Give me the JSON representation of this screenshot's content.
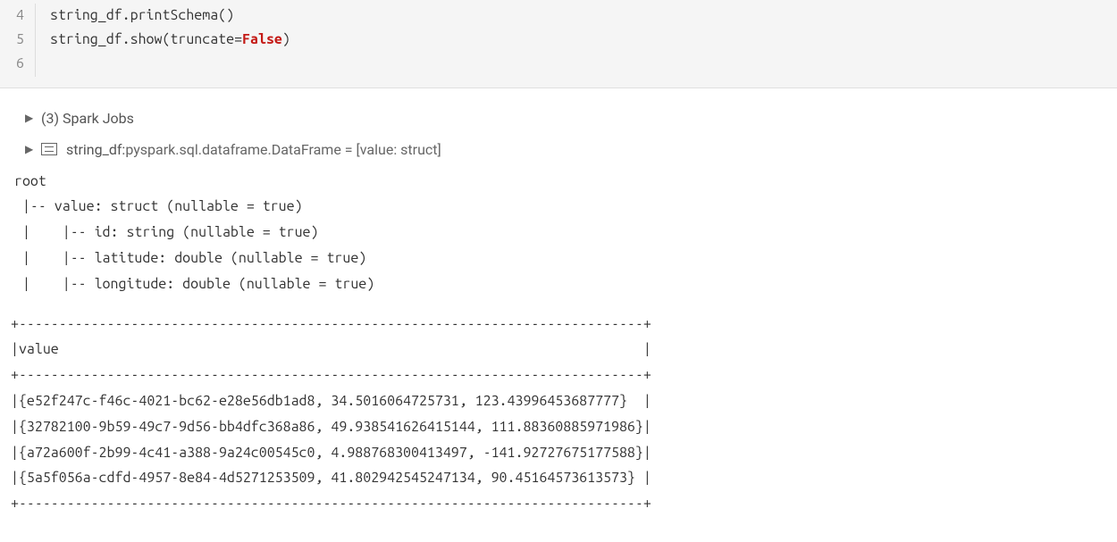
{
  "code": {
    "lines": [
      {
        "num": "4",
        "tokens": [
          {
            "t": "string_df",
            "c": ""
          },
          {
            "t": ".",
            "c": ""
          },
          {
            "t": "printSchema",
            "c": "code-method"
          },
          {
            "t": "()",
            "c": ""
          }
        ]
      },
      {
        "num": "5",
        "tokens": [
          {
            "t": "string_df",
            "c": ""
          },
          {
            "t": ".",
            "c": ""
          },
          {
            "t": "show",
            "c": "code-method"
          },
          {
            "t": "(",
            "c": ""
          },
          {
            "t": "truncate",
            "c": ""
          },
          {
            "t": "=",
            "c": ""
          },
          {
            "t": "False",
            "c": "code-keyword"
          },
          {
            "t": ")",
            "c": ""
          }
        ]
      },
      {
        "num": "6",
        "tokens": []
      }
    ]
  },
  "output": {
    "spark_jobs_label": "(3) Spark Jobs",
    "df_name": "string_df:",
    "df_type": "  pyspark.sql.dataframe.DataFrame = [value: struct]",
    "schema_lines": [
      "root",
      " |-- value: struct (nullable = true)",
      " |    |-- id: string (nullable = true)",
      " |    |-- latitude: double (nullable = true)",
      " |    |-- longitude: double (nullable = true)"
    ],
    "table_lines": [
      "+------------------------------------------------------------------------------+",
      "|value                                                                         |",
      "+------------------------------------------------------------------------------+",
      "|{e52f247c-f46c-4021-bc62-e28e56db1ad8, 34.5016064725731, 123.43996453687777}  |",
      "|{32782100-9b59-49c7-9d56-bb4dfc368a86, 49.938541626415144, 111.88360885971986}|",
      "|{a72a600f-2b99-4c41-a388-9a24c00545c0, 4.988768300413497, -141.92727675177588}|",
      "|{5a5f056a-cdfd-4957-8e84-4d5271253509, 41.802942545247134, 90.45164573613573} |",
      "+------------------------------------------------------------------------------+"
    ]
  }
}
